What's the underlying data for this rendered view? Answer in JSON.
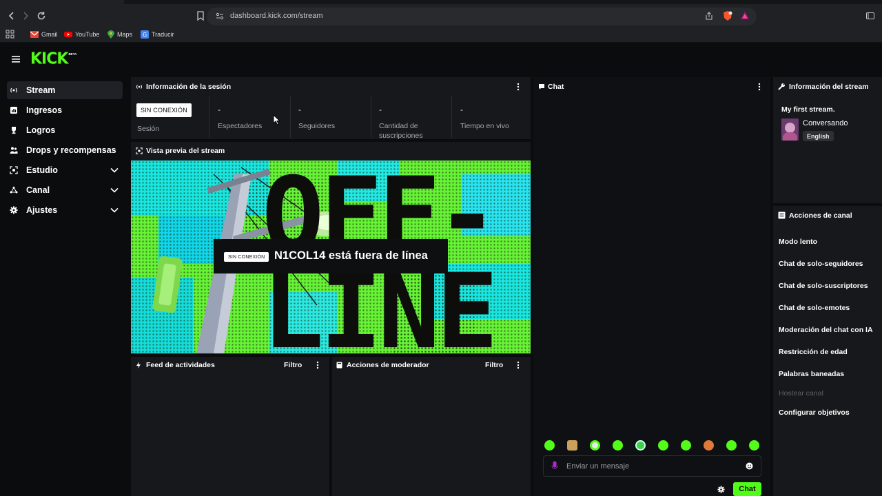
{
  "browser": {
    "url": "dashboard.kick.com/stream",
    "bookmarks": [
      {
        "label": "Gmail",
        "icon": "gmail-icon"
      },
      {
        "label": "YouTube",
        "icon": "youtube-icon"
      },
      {
        "label": "Maps",
        "icon": "maps-icon"
      },
      {
        "label": "Traducir",
        "icon": "translate-icon"
      }
    ]
  },
  "header": {
    "logo_text": "KICK",
    "logo_tag": "BETA"
  },
  "sidebar": {
    "items": [
      {
        "label": "Stream",
        "icon": "broadcast-icon"
      },
      {
        "label": "Ingresos",
        "icon": "chart-icon"
      },
      {
        "label": "Logros",
        "icon": "trophy-icon"
      },
      {
        "label": "Drops y recompensas",
        "icon": "people-icon"
      },
      {
        "label": "Estudio",
        "icon": "studio-icon"
      },
      {
        "label": "Canal",
        "icon": "channel-icon"
      },
      {
        "label": "Ajustes",
        "icon": "gear-icon"
      }
    ]
  },
  "session": {
    "title": "Información de la sesión",
    "status_badge": "SIN CONEXIÓN",
    "session_label": "Sesión",
    "stats": [
      {
        "value": "-",
        "label": "Espectadores"
      },
      {
        "value": "-",
        "label": "Seguidores"
      },
      {
        "value": "-",
        "label": "Cantidad de suscripciones"
      },
      {
        "value": "-",
        "label": "Tiempo en vivo"
      }
    ]
  },
  "preview": {
    "title": "Vista previa del stream",
    "badge": "SIN CONEXIÓN",
    "message": "N1COL14 está fuera de línea",
    "bg_text_1": "OFF-",
    "bg_text_2": "LINE"
  },
  "activity": {
    "title": "Feed de actividades",
    "filter": "Filtro"
  },
  "moderator": {
    "title": "Acciones de moderador",
    "filter": "Filtro"
  },
  "chat": {
    "title": "Chat",
    "placeholder": "Enviar un mensaje",
    "send_label": "Chat"
  },
  "stream_info": {
    "title": "Información del stream",
    "stream_title": "My first stream.",
    "category": "Conversando",
    "language": "English"
  },
  "channel_actions": {
    "title": "Acciones de canal",
    "items": [
      {
        "label": "Modo lento",
        "enabled": true
      },
      {
        "label": "Chat de solo-seguidores",
        "enabled": true
      },
      {
        "label": "Chat de solo-suscriptores",
        "enabled": true
      },
      {
        "label": "Chat de solo-emotes",
        "enabled": true
      },
      {
        "label": "Moderación del chat con IA",
        "enabled": true
      },
      {
        "label": "Restricción de edad",
        "enabled": true
      },
      {
        "label": "Palabras baneadas",
        "enabled": true
      },
      {
        "label": "Hostear canal",
        "enabled": false
      },
      {
        "label": "Configurar objetivos",
        "enabled": true
      }
    ]
  },
  "colors": {
    "accent": "#53fc18",
    "panel": "#17181b",
    "background": "#0b0c0e"
  }
}
